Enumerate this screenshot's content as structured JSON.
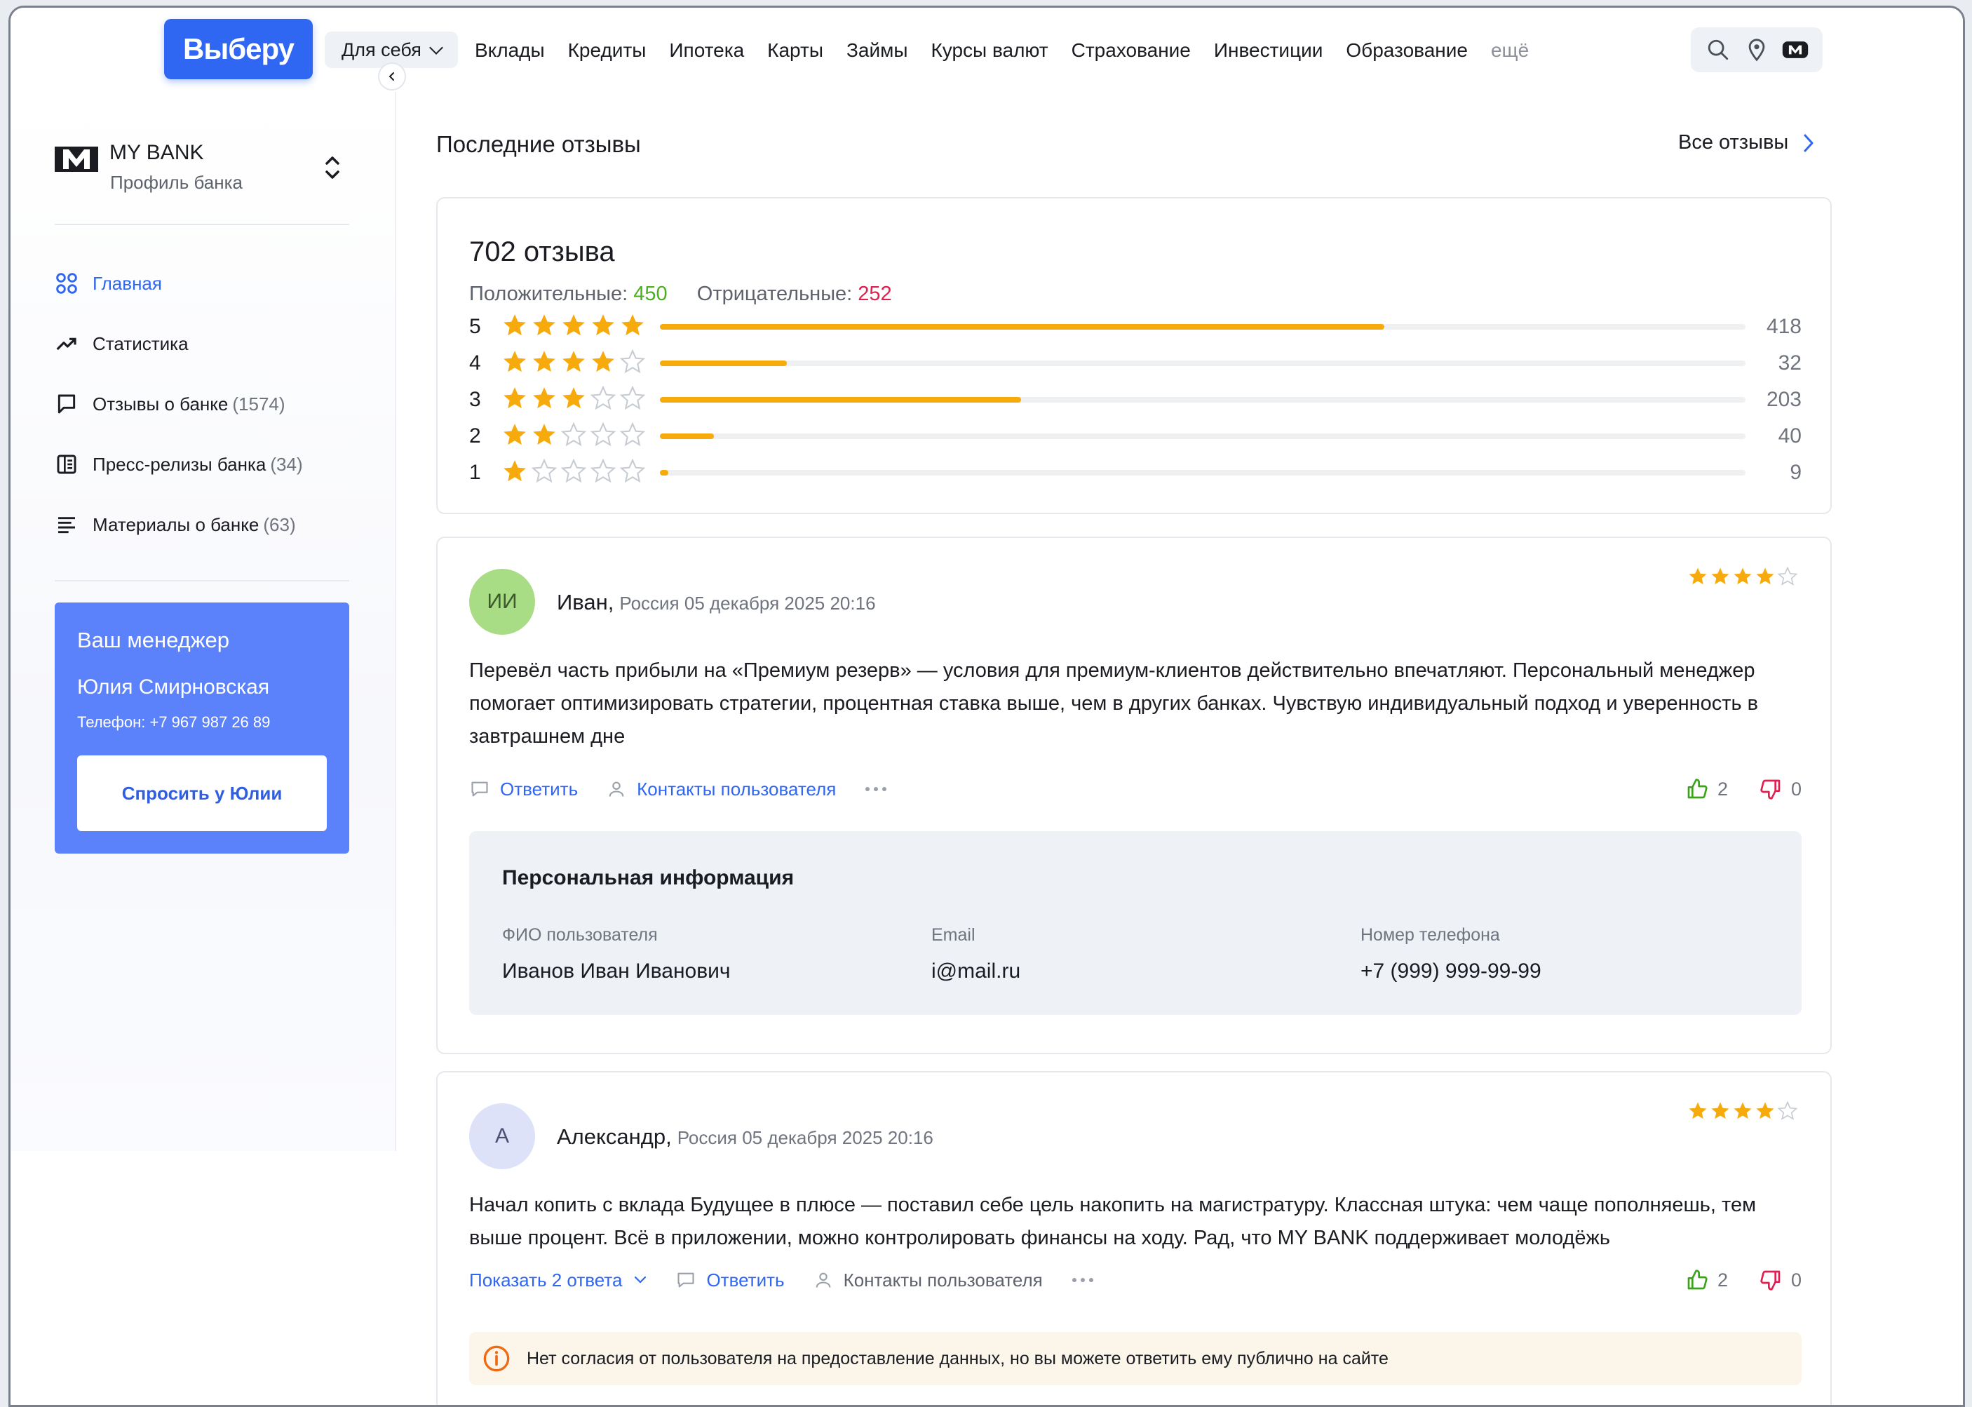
{
  "header": {
    "logo": "Выберу",
    "audience_select": "Для себя",
    "nav": [
      "Вклады",
      "Кредиты",
      "Ипотека",
      "Карты",
      "Займы",
      "Курсы валют",
      "Страхование",
      "Инвестиции",
      "Образование"
    ],
    "nav_more": "ещё",
    "icons": [
      "search-icon",
      "location-pin-icon",
      "bank-logo-icon"
    ]
  },
  "sidebar": {
    "bank_name": "MY BANK",
    "bank_subtitle": "Профиль банка",
    "items": [
      {
        "label": "Главная",
        "count": "",
        "icon": "grid-icon",
        "active": true
      },
      {
        "label": "Статистика",
        "count": "",
        "icon": "trend-up-icon",
        "active": false
      },
      {
        "label": "Отзывы о банке",
        "count": "(1574)",
        "icon": "chat-bubble-icon",
        "active": false
      },
      {
        "label": "Пресс-релизы банка",
        "count": "(34)",
        "icon": "newspaper-icon",
        "active": false
      },
      {
        "label": "Материалы о банке",
        "count": "(63)",
        "icon": "lines-icon",
        "active": false
      }
    ],
    "manager": {
      "title": "Ваш менеджер",
      "name": "Юлия Смирновская",
      "phone": "Телефон: +7 967 987 26 89",
      "button": "Спросить у Юлии"
    }
  },
  "main": {
    "title": "Последние отзывы",
    "all_reviews_link": "Все отзывы",
    "summary": {
      "total": "702 отзыва",
      "positive_label": "Положительные:",
      "positive_value": "450",
      "negative_label": "Отрицательные:",
      "negative_value": "252",
      "rows": [
        {
          "level": "5",
          "count": "418",
          "fraction": 0.667
        },
        {
          "level": "4",
          "count": "32",
          "fraction": 0.117
        },
        {
          "level": "3",
          "count": "203",
          "fraction": 0.333
        },
        {
          "level": "2",
          "count": "40",
          "fraction": 0.05
        },
        {
          "level": "1",
          "count": "9",
          "fraction": 0.008
        }
      ]
    },
    "reviews": [
      {
        "initials": "ИИ",
        "author": "Иван,",
        "meta": "Россия 05 декабря 2025 20:16",
        "rating": 4,
        "text": "Перевёл часть прибыли на «Премиум резерв» — условия для премиум-клиентов действительно впечатляют. Персональный менеджер помогает оптимизировать стратегии, процентная ставка выше, чем в других банках. Чувствую индивидуальный подход и уверенность в завтрашнем дне",
        "reply": "Ответить",
        "contacts": "Контакты пользователя",
        "likes": "2",
        "dislikes": "0",
        "personal": {
          "title": "Персональная информация",
          "fio_label": "ФИО пользователя",
          "fio": "Иванов Иван Иванович",
          "email_label": "Email",
          "email": "i@mail.ru",
          "phone_label": "Номер телефона",
          "phone": "+7 (999) 999-99-99"
        }
      },
      {
        "initials": "А",
        "author": "Александр,",
        "meta": "Россия 05 декабря 2025 20:16",
        "rating": 4,
        "text": "Начал копить с вклада Будущее в плюсе — поставил себе цель накопить на магистратуру. Классная штука: чем чаще пополняешь, тем выше процент. Всё в приложении, можно контролировать финансы на ходу. Рад, что MY BANK поддерживает молодёжь",
        "show_replies": "Показать 2 ответа",
        "reply": "Ответить",
        "contacts": "Контакты пользователя",
        "likes": "2",
        "dislikes": "0",
        "notice": "Нет согласия от пользователя на предоставление данных, но вы можете ответить ему публично на сайте"
      }
    ]
  },
  "colors": {
    "brand": "#2f66f2",
    "manager_card": "#5b82fa",
    "star": "#f7aa0c",
    "positive": "#4caf1f",
    "negative": "#e01f4e"
  }
}
